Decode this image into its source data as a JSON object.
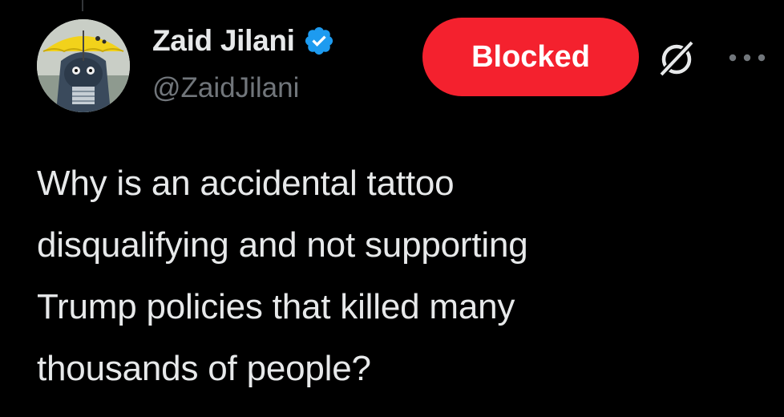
{
  "author": {
    "display_name": "Zaid Jilani",
    "handle": "@ZaidJilani",
    "verified": true,
    "avatar_icon": "avatar-umbrella-figure",
    "verified_icon": "verified-badge-icon",
    "verified_color": "#1d9bf0"
  },
  "header_actions": {
    "blocked_label": "Blocked",
    "blocked_color": "#f4212e",
    "grok_icon": "grok-icon",
    "more_icon": "more-horizontal-icon"
  },
  "tweet": {
    "text": "Why is an accidental tattoo\ndisqualifying and not supporting\nTrump policies that killed many\nthousands of people?"
  },
  "theme": {
    "background": "#000000",
    "text_primary": "#e7e9ea",
    "text_secondary": "#71767b"
  }
}
